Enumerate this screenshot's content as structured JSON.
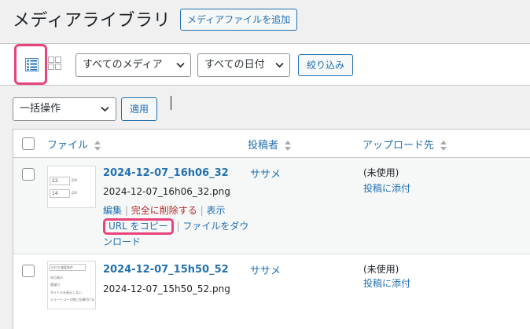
{
  "header": {
    "title": "メディアライブラリ",
    "add_button": "メディアファイルを追加"
  },
  "filters": {
    "media_type": "すべてのメディア",
    "date": "すべての日付",
    "filter_button": "絞り込み"
  },
  "bulk": {
    "action": "一括操作",
    "apply": "適用"
  },
  "table": {
    "columns": {
      "file": "ファイル",
      "author": "投稿者",
      "uploaded_to": "アップロード先"
    },
    "rows": [
      {
        "title": "2024-12-07_16h06_32",
        "filename": "2024-12-07_16h06_32.png",
        "author": "ササメ",
        "status": "(未使用)",
        "attach": "投稿に添付",
        "actions": {
          "edit": "編集",
          "delete": "完全に削除する",
          "view": "表示",
          "copy_url": "URL をコピー",
          "download": "ファイルをダウンロード"
        },
        "thumb": {
          "v1": "22",
          "v2": "14",
          "unit": "px"
        }
      },
      {
        "title": "2024-12-07_15h50_52",
        "filename": "2024-12-07_15h50_52.png",
        "author": "ササメ",
        "status": "(未使用)",
        "attach": "投稿に添付",
        "thumb": {
          "lines": [
            "日付と検索条件",
            "年月表示",
            "登録日",
            "タイトルを表示しない",
            "ショートコード例に先頭付ける"
          ]
        }
      }
    ]
  },
  "colors": {
    "link": "#2271b1",
    "highlight": "#e8437a",
    "delete": "#b32d2e"
  }
}
